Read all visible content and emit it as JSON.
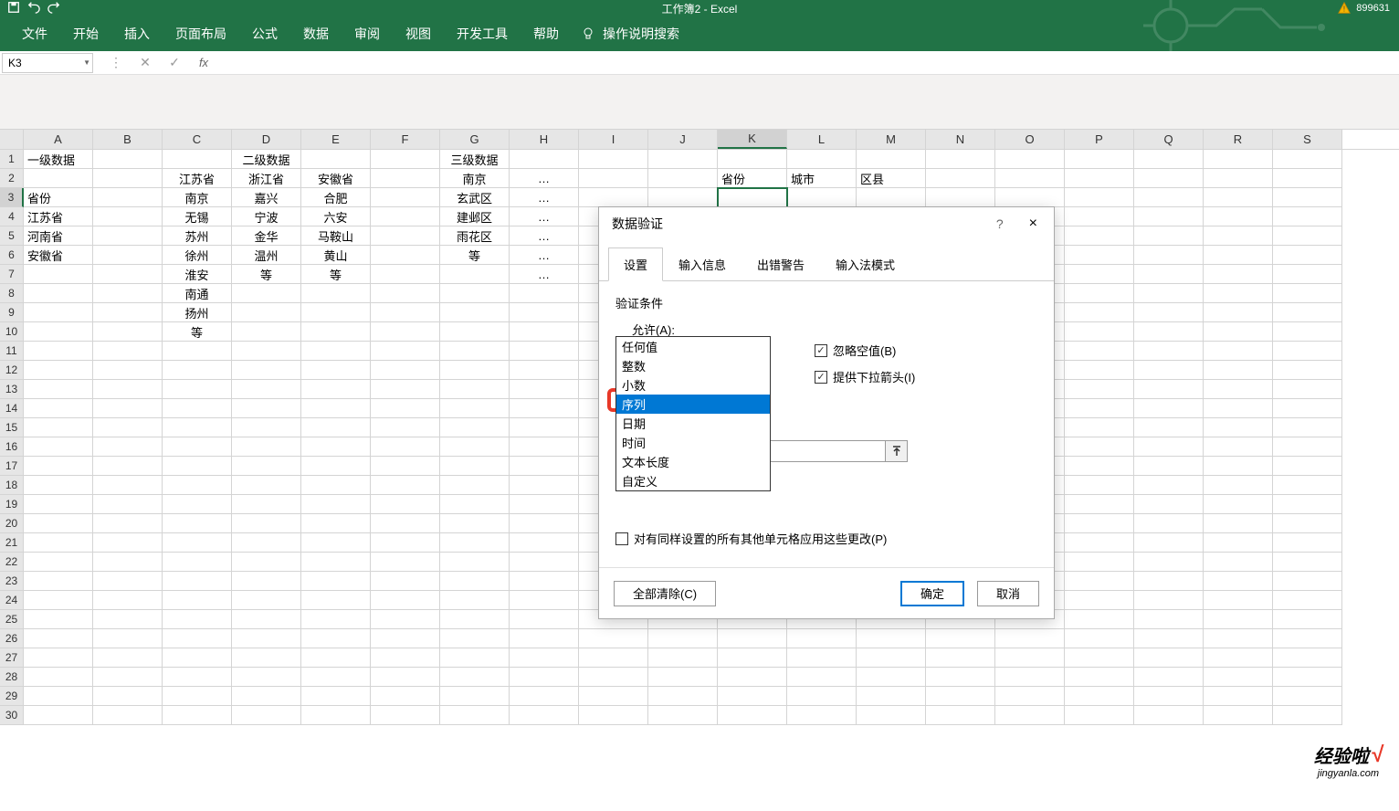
{
  "title_bar": {
    "doc_name": "工作簿2 - Excel",
    "account_id": "899631"
  },
  "ribbon": {
    "tabs": [
      "文件",
      "开始",
      "插入",
      "页面布局",
      "公式",
      "数据",
      "审阅",
      "视图",
      "开发工具",
      "帮助"
    ],
    "tell_me": "操作说明搜索"
  },
  "formula_bar": {
    "name_box": "K3",
    "fx": "fx"
  },
  "columns": [
    "A",
    "B",
    "C",
    "D",
    "E",
    "F",
    "G",
    "H",
    "I",
    "J",
    "K",
    "L",
    "M",
    "N",
    "O",
    "P",
    "Q",
    "R",
    "S"
  ],
  "active_col": "K",
  "active_row": "3",
  "rows": {
    "1": {
      "A": "一级数据",
      "D": "二级数据",
      "G": "三级数据"
    },
    "2": {
      "C": "江苏省",
      "D": "浙江省",
      "E": "安徽省",
      "G": "南京",
      "H": "…",
      "K": "省份",
      "L": "城市",
      "M": "区县"
    },
    "3": {
      "A": "省份",
      "C": "南京",
      "D": "嘉兴",
      "E": "合肥",
      "G": "玄武区",
      "H": "…"
    },
    "4": {
      "A": "江苏省",
      "C": "无锡",
      "D": "宁波",
      "E": "六安",
      "G": "建邺区",
      "H": "…"
    },
    "5": {
      "A": "河南省",
      "C": "苏州",
      "D": "金华",
      "E": "马鞍山",
      "G": "雨花区",
      "H": "…"
    },
    "6": {
      "A": "安徽省",
      "C": "徐州",
      "D": "温州",
      "E": "黄山",
      "G": "等",
      "H": "…"
    },
    "7": {
      "C": "淮安",
      "D": "等",
      "E": "等",
      "H": "…"
    },
    "8": {
      "C": "南通"
    },
    "9": {
      "C": "扬州"
    },
    "10": {
      "C": "等"
    }
  },
  "dialog": {
    "title": "数据验证",
    "help": "?",
    "close": "×",
    "tabs": [
      "设置",
      "输入信息",
      "出错警告",
      "输入法模式"
    ],
    "active_tab": "设置",
    "section_label": "验证条件",
    "allow_label": "允许(A):",
    "allow_value": "序列",
    "dropdown_options": [
      "任何值",
      "整数",
      "小数",
      "序列",
      "日期",
      "时间",
      "文本长度",
      "自定义"
    ],
    "dropdown_selected": "序列",
    "ignore_blank": "忽略空值(B)",
    "provide_dropdown": "提供下拉箭头(I)",
    "apply_all": "对有同样设置的所有其他单元格应用这些更改(P)",
    "clear_all": "全部清除(C)",
    "ok": "确定",
    "cancel": "取消"
  },
  "watermark": {
    "text": "经验啦",
    "url": "jingyanla.com"
  }
}
